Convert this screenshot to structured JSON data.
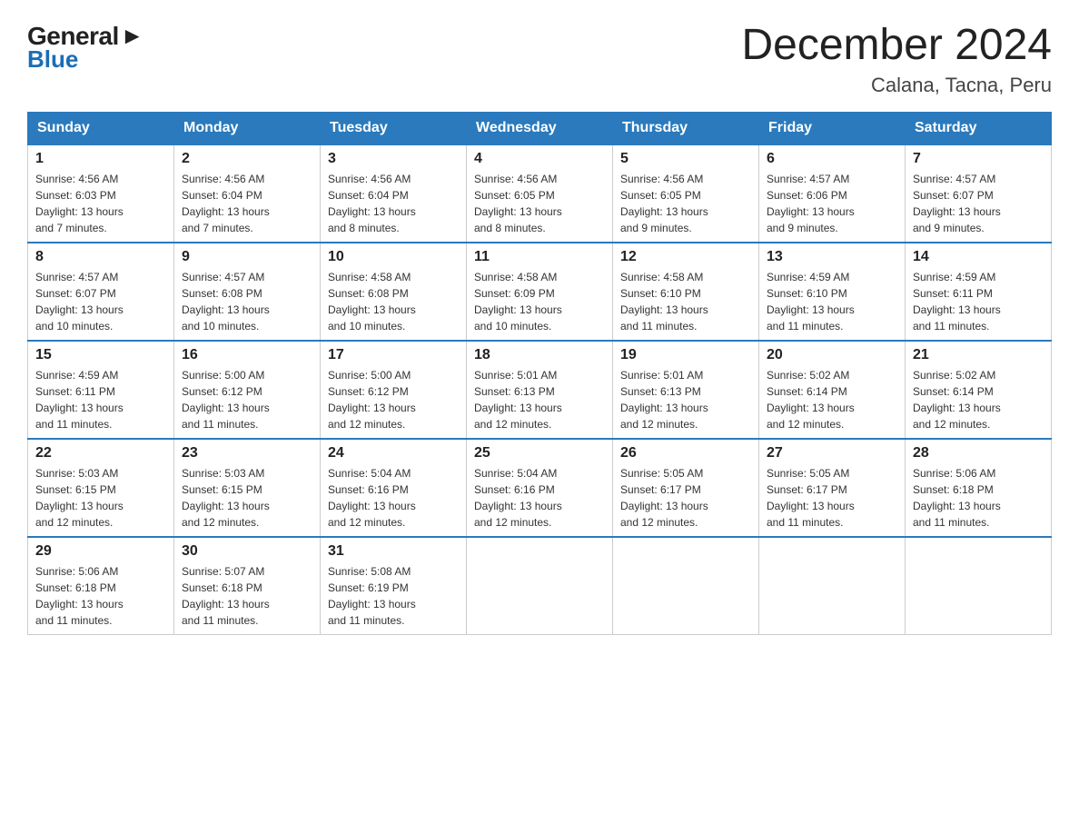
{
  "header": {
    "logo_general": "General",
    "logo_blue": "Blue",
    "month_title": "December 2024",
    "location": "Calana, Tacna, Peru"
  },
  "weekdays": [
    "Sunday",
    "Monday",
    "Tuesday",
    "Wednesday",
    "Thursday",
    "Friday",
    "Saturday"
  ],
  "weeks": [
    [
      {
        "day": "1",
        "sunrise": "4:56 AM",
        "sunset": "6:03 PM",
        "daylight": "13 hours and 7 minutes."
      },
      {
        "day": "2",
        "sunrise": "4:56 AM",
        "sunset": "6:04 PM",
        "daylight": "13 hours and 7 minutes."
      },
      {
        "day": "3",
        "sunrise": "4:56 AM",
        "sunset": "6:04 PM",
        "daylight": "13 hours and 8 minutes."
      },
      {
        "day": "4",
        "sunrise": "4:56 AM",
        "sunset": "6:05 PM",
        "daylight": "13 hours and 8 minutes."
      },
      {
        "day": "5",
        "sunrise": "4:56 AM",
        "sunset": "6:05 PM",
        "daylight": "13 hours and 9 minutes."
      },
      {
        "day": "6",
        "sunrise": "4:57 AM",
        "sunset": "6:06 PM",
        "daylight": "13 hours and 9 minutes."
      },
      {
        "day": "7",
        "sunrise": "4:57 AM",
        "sunset": "6:07 PM",
        "daylight": "13 hours and 9 minutes."
      }
    ],
    [
      {
        "day": "8",
        "sunrise": "4:57 AM",
        "sunset": "6:07 PM",
        "daylight": "13 hours and 10 minutes."
      },
      {
        "day": "9",
        "sunrise": "4:57 AM",
        "sunset": "6:08 PM",
        "daylight": "13 hours and 10 minutes."
      },
      {
        "day": "10",
        "sunrise": "4:58 AM",
        "sunset": "6:08 PM",
        "daylight": "13 hours and 10 minutes."
      },
      {
        "day": "11",
        "sunrise": "4:58 AM",
        "sunset": "6:09 PM",
        "daylight": "13 hours and 10 minutes."
      },
      {
        "day": "12",
        "sunrise": "4:58 AM",
        "sunset": "6:10 PM",
        "daylight": "13 hours and 11 minutes."
      },
      {
        "day": "13",
        "sunrise": "4:59 AM",
        "sunset": "6:10 PM",
        "daylight": "13 hours and 11 minutes."
      },
      {
        "day": "14",
        "sunrise": "4:59 AM",
        "sunset": "6:11 PM",
        "daylight": "13 hours and 11 minutes."
      }
    ],
    [
      {
        "day": "15",
        "sunrise": "4:59 AM",
        "sunset": "6:11 PM",
        "daylight": "13 hours and 11 minutes."
      },
      {
        "day": "16",
        "sunrise": "5:00 AM",
        "sunset": "6:12 PM",
        "daylight": "13 hours and 11 minutes."
      },
      {
        "day": "17",
        "sunrise": "5:00 AM",
        "sunset": "6:12 PM",
        "daylight": "13 hours and 12 minutes."
      },
      {
        "day": "18",
        "sunrise": "5:01 AM",
        "sunset": "6:13 PM",
        "daylight": "13 hours and 12 minutes."
      },
      {
        "day": "19",
        "sunrise": "5:01 AM",
        "sunset": "6:13 PM",
        "daylight": "13 hours and 12 minutes."
      },
      {
        "day": "20",
        "sunrise": "5:02 AM",
        "sunset": "6:14 PM",
        "daylight": "13 hours and 12 minutes."
      },
      {
        "day": "21",
        "sunrise": "5:02 AM",
        "sunset": "6:14 PM",
        "daylight": "13 hours and 12 minutes."
      }
    ],
    [
      {
        "day": "22",
        "sunrise": "5:03 AM",
        "sunset": "6:15 PM",
        "daylight": "13 hours and 12 minutes."
      },
      {
        "day": "23",
        "sunrise": "5:03 AM",
        "sunset": "6:15 PM",
        "daylight": "13 hours and 12 minutes."
      },
      {
        "day": "24",
        "sunrise": "5:04 AM",
        "sunset": "6:16 PM",
        "daylight": "13 hours and 12 minutes."
      },
      {
        "day": "25",
        "sunrise": "5:04 AM",
        "sunset": "6:16 PM",
        "daylight": "13 hours and 12 minutes."
      },
      {
        "day": "26",
        "sunrise": "5:05 AM",
        "sunset": "6:17 PM",
        "daylight": "13 hours and 12 minutes."
      },
      {
        "day": "27",
        "sunrise": "5:05 AM",
        "sunset": "6:17 PM",
        "daylight": "13 hours and 11 minutes."
      },
      {
        "day": "28",
        "sunrise": "5:06 AM",
        "sunset": "6:18 PM",
        "daylight": "13 hours and 11 minutes."
      }
    ],
    [
      {
        "day": "29",
        "sunrise": "5:06 AM",
        "sunset": "6:18 PM",
        "daylight": "13 hours and 11 minutes."
      },
      {
        "day": "30",
        "sunrise": "5:07 AM",
        "sunset": "6:18 PM",
        "daylight": "13 hours and 11 minutes."
      },
      {
        "day": "31",
        "sunrise": "5:08 AM",
        "sunset": "6:19 PM",
        "daylight": "13 hours and 11 minutes."
      },
      null,
      null,
      null,
      null
    ]
  ],
  "labels": {
    "sunrise": "Sunrise:",
    "sunset": "Sunset:",
    "daylight": "Daylight:"
  }
}
